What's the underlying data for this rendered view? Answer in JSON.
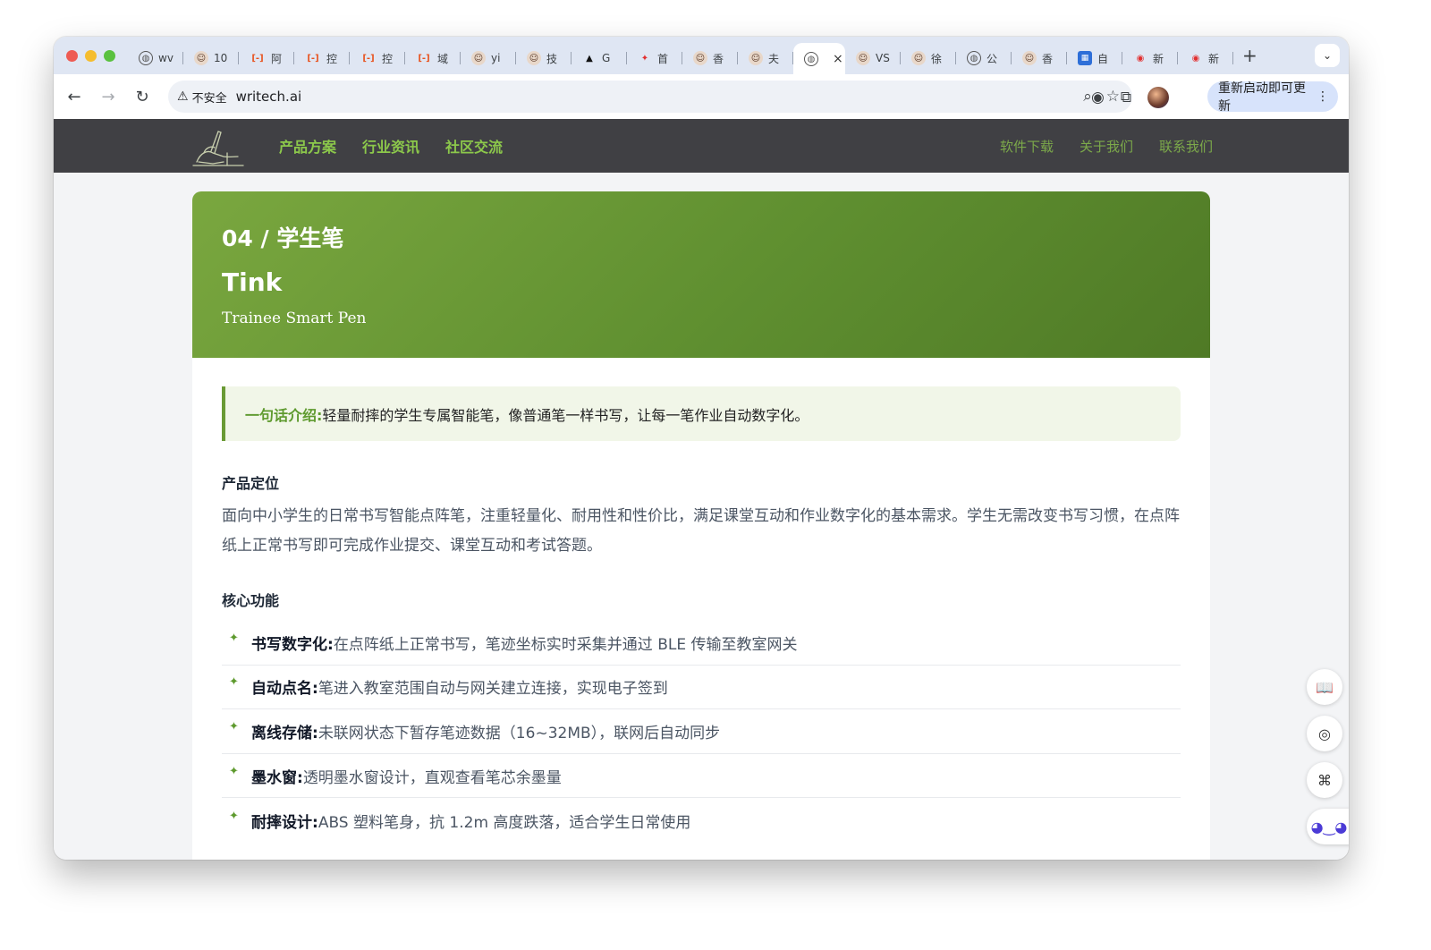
{
  "browser": {
    "tabs": [
      {
        "icon": "globe-icon",
        "label": "wv"
      },
      {
        "icon": "avatar-icon",
        "label": "10"
      },
      {
        "icon": "bracket-icon",
        "label": "阿"
      },
      {
        "icon": "bracket-icon",
        "label": "控"
      },
      {
        "icon": "bracket-icon",
        "label": "控"
      },
      {
        "icon": "bracket-icon",
        "label": "域"
      },
      {
        "icon": "avatar-icon",
        "label": "yi"
      },
      {
        "icon": "avatar-icon",
        "label": "技"
      },
      {
        "icon": "triangle-icon",
        "label": "G"
      },
      {
        "icon": "flame-icon",
        "label": "首"
      },
      {
        "icon": "avatar-icon",
        "label": "香"
      },
      {
        "icon": "avatar-icon",
        "label": "夫"
      },
      {
        "icon": "globe-icon",
        "label": "",
        "active": true
      },
      {
        "icon": "avatar-icon",
        "label": "VS"
      },
      {
        "icon": "avatar-icon",
        "label": "徐"
      },
      {
        "icon": "globe-icon",
        "label": "公"
      },
      {
        "icon": "avatar-icon",
        "label": "香"
      },
      {
        "icon": "blue-square-icon",
        "label": "自"
      },
      {
        "icon": "weibo-icon",
        "label": "新"
      },
      {
        "icon": "weibo-icon",
        "label": "新"
      }
    ],
    "security_label": "不安全",
    "url": "writech.ai",
    "update_label": "重新启动即可更新"
  },
  "site": {
    "nav_left": [
      "产品方案",
      "行业资讯",
      "社区交流"
    ],
    "nav_right": [
      "软件下载",
      "关于我们",
      "联系我们"
    ]
  },
  "product": {
    "kicker": "04 / 学生笔",
    "name": "Tink",
    "subtitle": "Trainee Smart Pen",
    "intro_label": "一句话介绍:",
    "intro_text": "轻量耐摔的学生专属智能笔，像普通笔一样书写，让每一笔作业自动数字化。",
    "positioning_heading": "产品定位",
    "positioning_text": "面向中小学生的日常书写智能点阵笔，注重轻量化、耐用性和性价比，满足课堂互动和作业数字化的基本需求。学生无需改变书写习惯，在点阵纸上正常书写即可完成作业提交、课堂互动和考试答题。",
    "features_heading": "核心功能",
    "features": [
      {
        "title": "书写数字化:",
        "text": "在点阵纸上正常书写，笔迹坐标实时采集并通过 BLE 传输至教室网关"
      },
      {
        "title": "自动点名:",
        "text": "笔进入教室范围自动与网关建立连接，实现电子签到"
      },
      {
        "title": "离线存储:",
        "text": "未联网状态下暂存笔迹数据（16~32MB），联网后自动同步"
      },
      {
        "title": "墨水窗:",
        "text": "透明墨水窗设计，直观查看笔芯余墨量"
      },
      {
        "title": "耐摔设计:",
        "text": "ABS 塑料笔身，抗 1.2m 高度跌落，适合学生日常使用"
      }
    ]
  },
  "colors": {
    "accent_green": "#6a9a35",
    "nav_bg": "#404044"
  }
}
